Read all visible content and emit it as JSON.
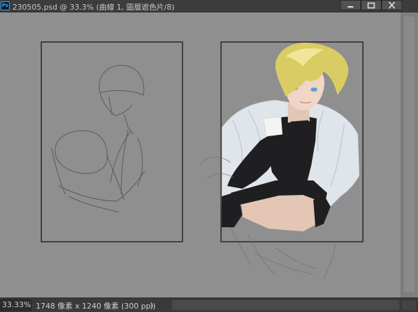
{
  "window": {
    "app_icon": "Ps",
    "title": "230505.psd @ 33.3% (曲線 1, 圖層遮色片/8)",
    "buttons": [
      "minimize-icon",
      "maximize-icon",
      "close-icon"
    ]
  },
  "status": {
    "zoom": "33.33%",
    "doc_info": "1748 像素 x 1240 像素 (300 ppi)",
    "arrow": "〉"
  },
  "colors": {
    "canvas_bg": "#8f8f8f",
    "hair": "#d9cc62",
    "skin": "#e3c6b4",
    "jacket": "#dfe5ea",
    "outfit": "#1f1f22"
  }
}
